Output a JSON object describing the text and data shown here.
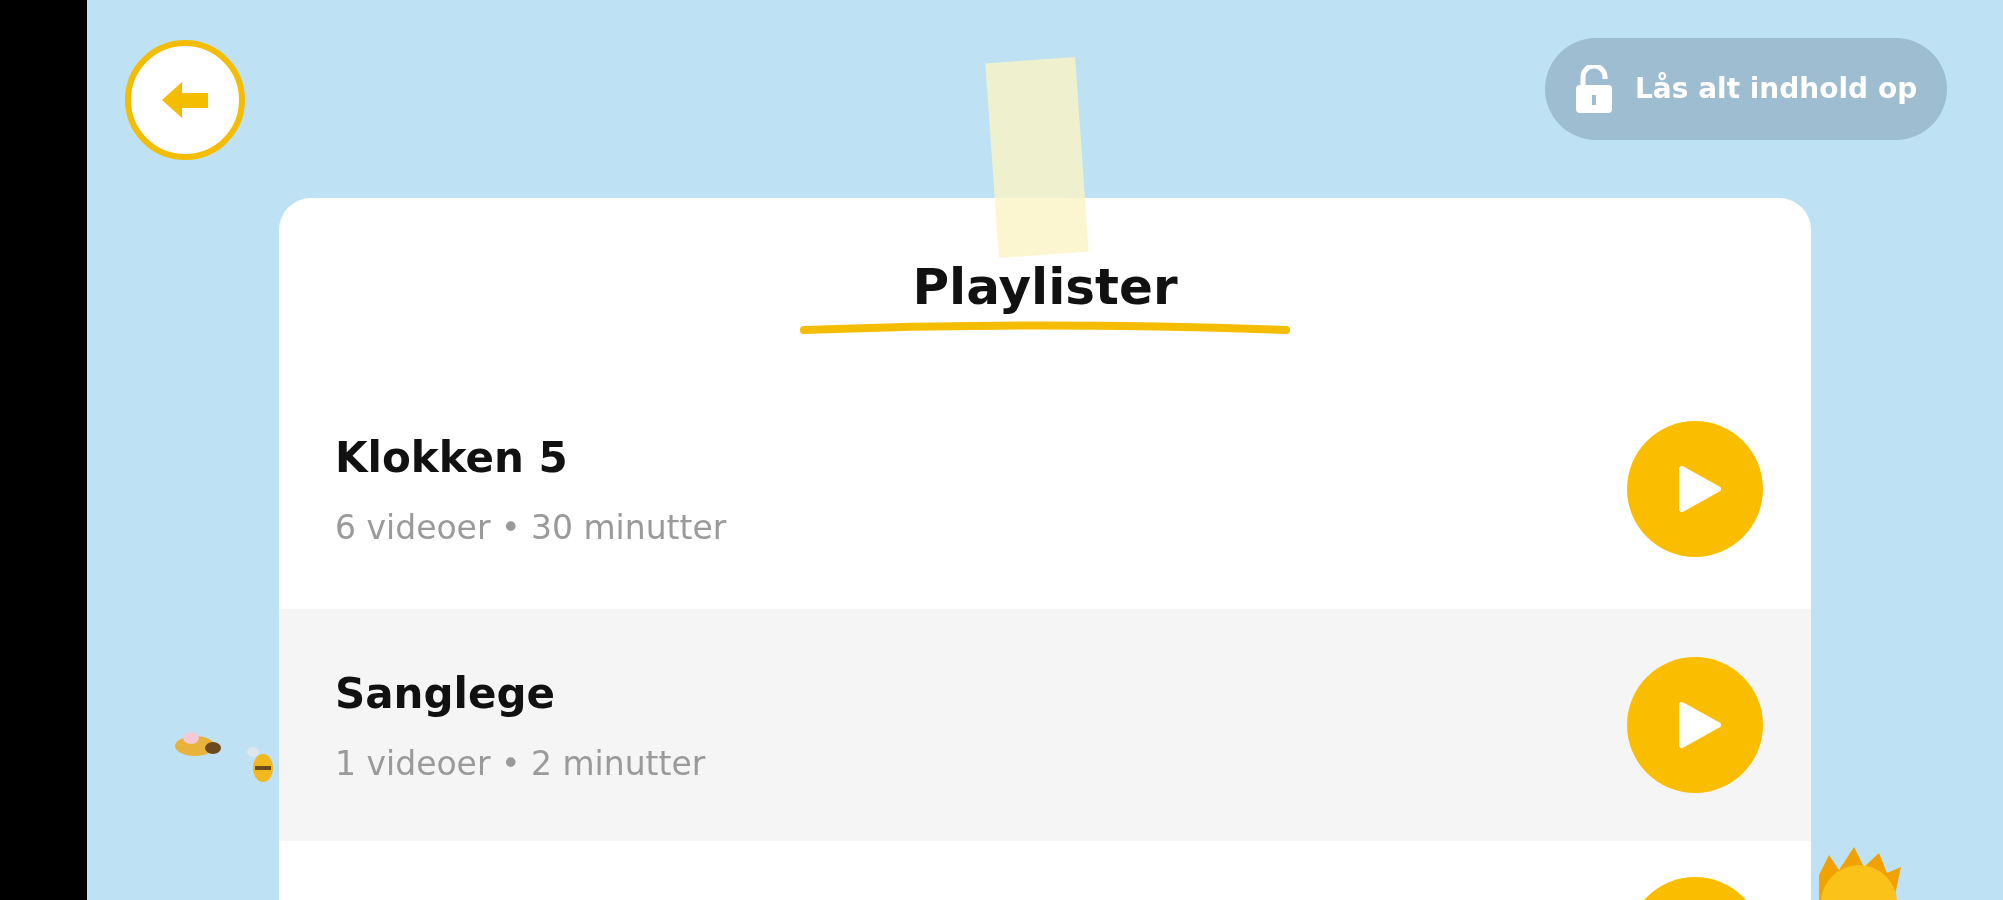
{
  "back_button": {
    "kind": "back"
  },
  "unlock_button": {
    "label": "Lås alt indhold op"
  },
  "title": "Playlister",
  "playlists": [
    {
      "title": "Klokken 5",
      "videos": "6 videoer",
      "separator": "•",
      "duration": "30 minutter"
    },
    {
      "title": "Sanglege",
      "videos": "1 videoer",
      "separator": "•",
      "duration": "2 minutter"
    },
    {
      "kind": "partial"
    }
  ]
}
